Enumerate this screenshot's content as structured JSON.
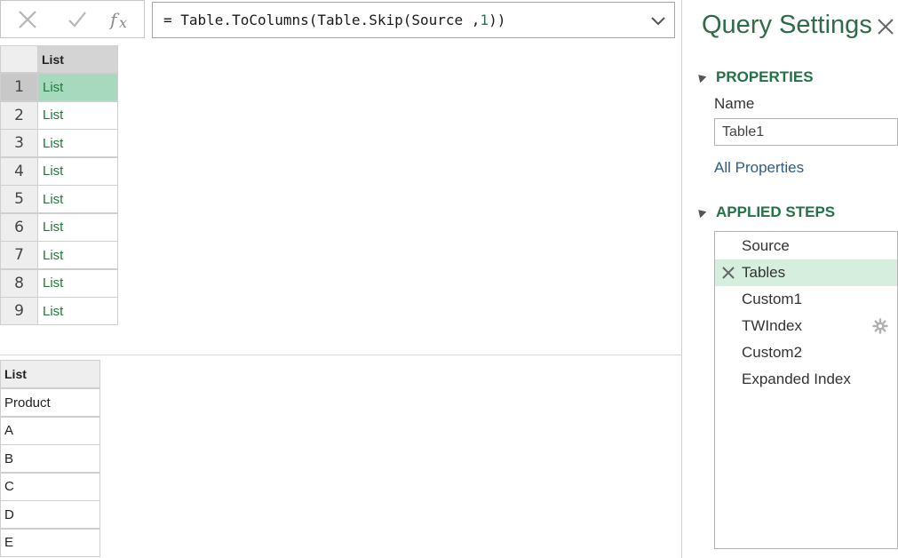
{
  "formula": {
    "prefix": "= Table.ToColumns(Table.Skip(Source ,",
    "number": "1",
    "suffix": "))"
  },
  "grid": {
    "column_header": "List",
    "rows": [
      {
        "n": "1",
        "v": "List"
      },
      {
        "n": "2",
        "v": "List"
      },
      {
        "n": "3",
        "v": "List"
      },
      {
        "n": "4",
        "v": "List"
      },
      {
        "n": "5",
        "v": "List"
      },
      {
        "n": "6",
        "v": "List"
      },
      {
        "n": "7",
        "v": "List"
      },
      {
        "n": "8",
        "v": "List"
      },
      {
        "n": "9",
        "v": "List"
      }
    ],
    "selected_row": 0
  },
  "preview": {
    "header": "List",
    "items": [
      "Product",
      "A",
      "B",
      "C",
      "D",
      "E"
    ]
  },
  "panel": {
    "title": "Query Settings",
    "properties_label": "PROPERTIES",
    "name_label": "Name",
    "name_value": "Table1",
    "all_properties_link": "All Properties",
    "applied_steps_label": "APPLIED STEPS",
    "steps": [
      "Source",
      "Tables",
      "Custom1",
      "TWIndex",
      "Custom2",
      "Expanded Index"
    ],
    "selected_step": 1,
    "gear_step": 3
  },
  "colors": {
    "accent_green": "#217346",
    "selected_cell": "#a7d9bf",
    "selected_step": "#d6eede",
    "link_blue": "#2e5d8a"
  }
}
